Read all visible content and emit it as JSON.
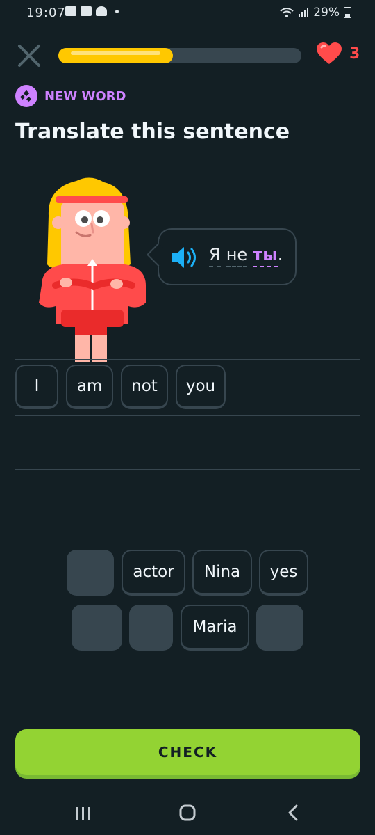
{
  "status": {
    "time": "19:07",
    "battery": "29%"
  },
  "header": {
    "hearts_count": "3",
    "progress_fraction": 0.47
  },
  "badge": {
    "label": "NEW WORD"
  },
  "title": "Translate this sentence",
  "bubble": {
    "words": [
      "Я",
      "не",
      "ты",
      "."
    ]
  },
  "answer_tiles": [
    "I",
    "am",
    "not",
    "you"
  ],
  "word_bank": [
    "actor",
    "Nina",
    "yes",
    "Maria"
  ],
  "check_label": "CHECK",
  "colors": {
    "background": "#131f24",
    "accent_yellow": "#ffc800",
    "accent_purple": "#ce82ff",
    "check_green": "#93d333",
    "heart_red": "#ff4b4b",
    "speaker_blue": "#1cb0f6"
  },
  "icons": [
    "close-icon",
    "heart-icon",
    "new-word-icon",
    "speaker-icon",
    "recents-icon",
    "home-icon",
    "back-icon"
  ]
}
